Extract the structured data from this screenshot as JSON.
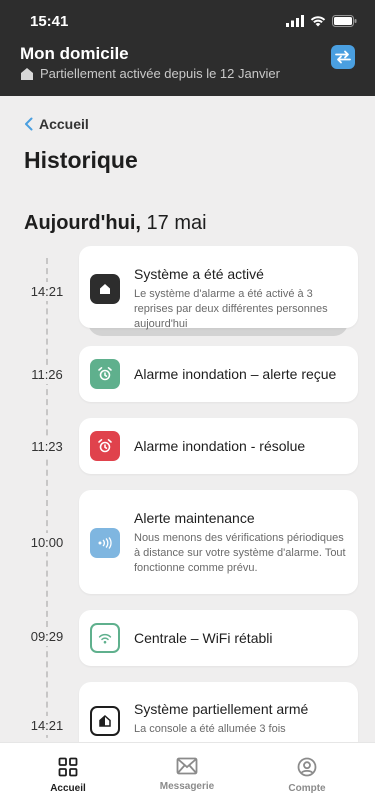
{
  "status_bar": {
    "time": "15:41"
  },
  "header": {
    "title": "Mon domicile",
    "status": "Partiellement activée depuis le 12 Janvier"
  },
  "nav": {
    "back_label": "Accueil"
  },
  "page": {
    "title": "Historique",
    "date_day": "Aujourd'hui,",
    "date_rest": " 17 mai"
  },
  "events": [
    {
      "time": "14:21",
      "title": "Système a été activé",
      "desc": "Le système d'alarme a été activé à 3 reprises par deux différentes personnes aujourd'hui",
      "icon": "home-icon",
      "color": "#2d2d2d"
    },
    {
      "time": "11:26",
      "title": "Alarme inondation – alerte reçue",
      "desc": "",
      "icon": "alarm-icon",
      "color": "#5fb08d"
    },
    {
      "time": "11:23",
      "title": "Alarme inondation - résolue",
      "desc": "",
      "icon": "alarm-icon",
      "color": "#e0424c"
    },
    {
      "time": "10:00",
      "title": "Alerte maintenance",
      "desc": "Nous menons des vérifications périodiques à distance sur votre système d'alarme. Tout fonctionne comme prévu.",
      "icon": "signal-icon",
      "color": "#7fb6e0"
    },
    {
      "time": "09:29",
      "title": "Centrale – WiFi rétabli",
      "desc": "",
      "icon": "wifi-icon",
      "color": "#5fb08d"
    },
    {
      "time": "14:21",
      "title": "Système partiellement armé",
      "desc": "La console a été allumée 3 fois",
      "icon": "partial-home-icon",
      "color": "#1e1e1e"
    }
  ],
  "bottom_nav": {
    "items": [
      {
        "label": "Accueil",
        "icon": "grid-icon",
        "active": true
      },
      {
        "label": "Messagerie",
        "icon": "mail-icon",
        "active": false
      },
      {
        "label": "Compte",
        "icon": "account-icon",
        "active": false
      }
    ]
  }
}
